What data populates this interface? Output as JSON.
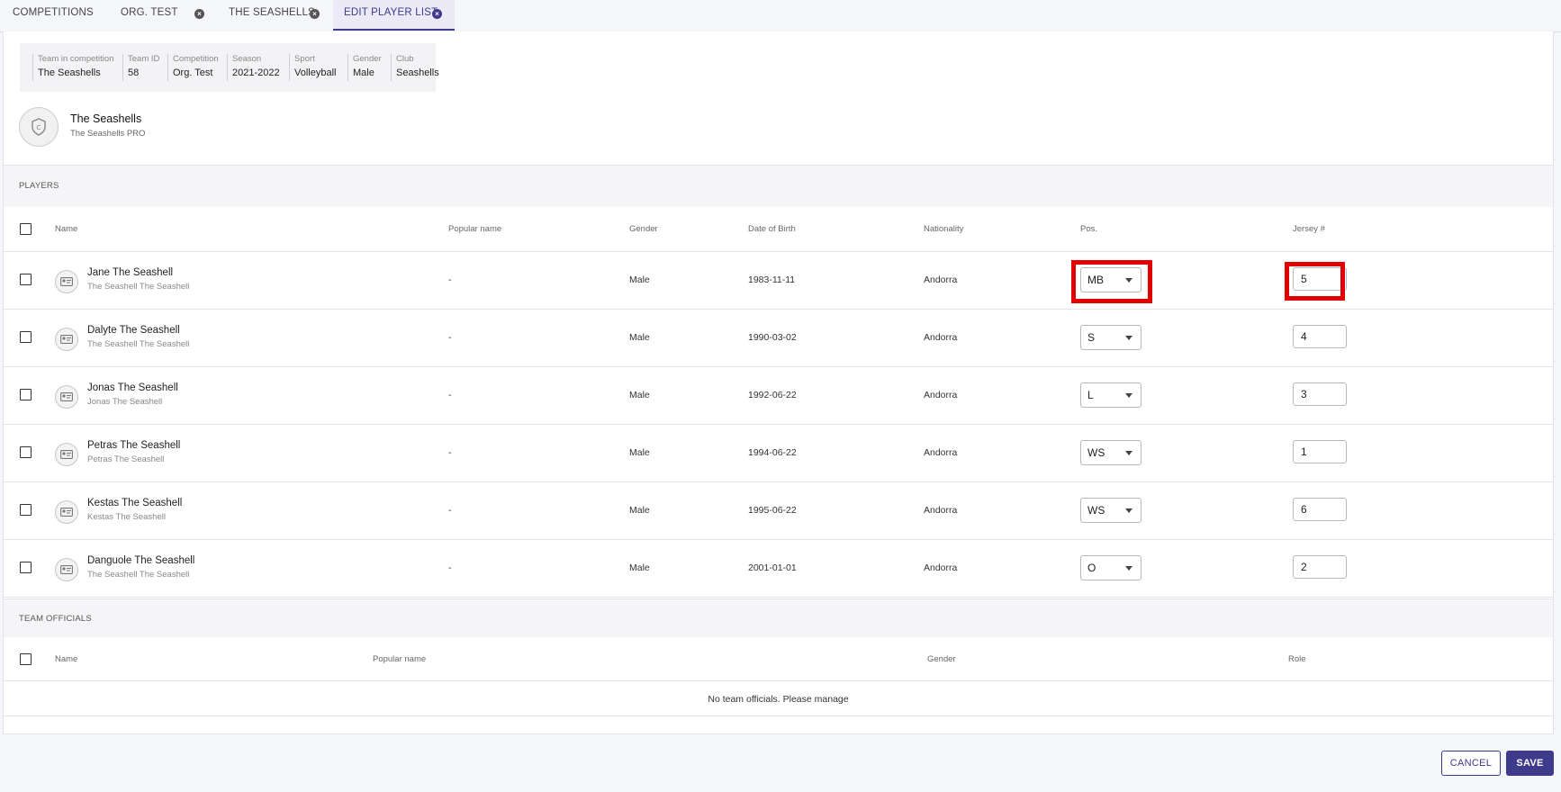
{
  "tabs": [
    {
      "label": "COMPETITIONS",
      "closable": false
    },
    {
      "label": "ORG. TEST",
      "closable": true
    },
    {
      "label": "THE SEASHELLS",
      "closable": true
    },
    {
      "label": "EDIT PLAYER LIST",
      "closable": true,
      "active": true
    }
  ],
  "team_info": {
    "team_label": "Team in competition",
    "team_value": "The Seashells",
    "id_label": "Team ID",
    "id_value": "58",
    "competition_label": "Competition",
    "competition_value": "Org. Test",
    "season_label": "Season",
    "season_value": "2021-2022",
    "sport_label": "Sport",
    "sport_value": "Volleyball",
    "gender_label": "Gender",
    "gender_value": "Male",
    "club_label": "Club",
    "club_value": "Seashells"
  },
  "team": {
    "name": "The Seashells",
    "subtitle": "The Seashells PRO"
  },
  "players_section": {
    "title": "PLAYERS",
    "columns": {
      "name": "Name",
      "popular": "Popular name",
      "gender": "Gender",
      "dob": "Date of Birth",
      "nationality": "Nationality",
      "pos": "Pos.",
      "jersey": "Jersey #"
    },
    "rows": [
      {
        "name": "Jane The Seashell",
        "sub": "The Seashell The Seashell",
        "popular": "-",
        "gender": "Male",
        "dob": "1983-11-11",
        "nationality": "Andorra",
        "pos": "MB",
        "jersey": "5"
      },
      {
        "name": "Dalyte The Seashell",
        "sub": "The Seashell The Seashell",
        "popular": "-",
        "gender": "Male",
        "dob": "1990-03-02",
        "nationality": "Andorra",
        "pos": "S",
        "jersey": "4"
      },
      {
        "name": "Jonas The Seashell",
        "sub": "Jonas The Seashell",
        "popular": "-",
        "gender": "Male",
        "dob": "1992-06-22",
        "nationality": "Andorra",
        "pos": "L",
        "jersey": "3"
      },
      {
        "name": "Petras The Seashell",
        "sub": "Petras The Seashell",
        "popular": "-",
        "gender": "Male",
        "dob": "1994-06-22",
        "nationality": "Andorra",
        "pos": "WS",
        "jersey": "1"
      },
      {
        "name": "Kestas The Seashell",
        "sub": "Kestas The Seashell",
        "popular": "-",
        "gender": "Male",
        "dob": "1995-06-22",
        "nationality": "Andorra",
        "pos": "WS",
        "jersey": "6"
      },
      {
        "name": "Danguole The Seashell",
        "sub": "The Seashell The Seashell",
        "popular": "-",
        "gender": "Male",
        "dob": "2001-01-01",
        "nationality": "Andorra",
        "pos": "O",
        "jersey": "2"
      }
    ]
  },
  "officials_section": {
    "title": "TEAM OFFICIALS",
    "columns": {
      "name": "Name",
      "popular": "Popular name",
      "gender": "Gender",
      "role": "Role"
    },
    "empty_text": "No team officials. Please manage"
  },
  "actions": {
    "cancel": "CANCEL",
    "save": "SAVE"
  },
  "colors": {
    "accent": "#3e3a8c",
    "highlight": "#e30000"
  }
}
